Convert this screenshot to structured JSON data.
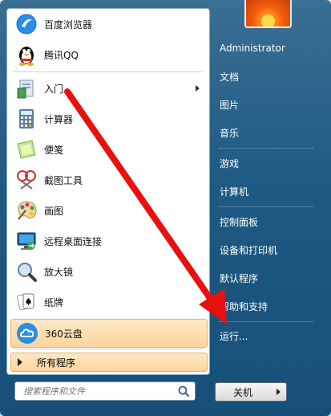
{
  "pinned_items": [
    {
      "name": "baidu-browser",
      "label": "百度浏览器",
      "icon": "baidu-browser-icon"
    },
    {
      "name": "tencent-qq",
      "label": "腾讯QQ",
      "icon": "qq-penguin-icon"
    }
  ],
  "recent_items": [
    {
      "name": "getting-started",
      "label": "入门",
      "icon": "getting-started-icon",
      "has_submenu": true
    },
    {
      "name": "calculator",
      "label": "计算器",
      "icon": "calculator-icon"
    },
    {
      "name": "sticky-notes",
      "label": "便笺",
      "icon": "sticky-notes-icon"
    },
    {
      "name": "snipping-tool",
      "label": "截图工具",
      "icon": "scissors-icon"
    },
    {
      "name": "paint",
      "label": "画图",
      "icon": "paint-palette-icon"
    },
    {
      "name": "remote-desktop",
      "label": "远程桌面连接",
      "icon": "remote-desktop-icon"
    },
    {
      "name": "magnifier",
      "label": "放大镜",
      "icon": "magnifier-icon"
    },
    {
      "name": "solitaire",
      "label": "纸牌",
      "icon": "cards-icon"
    },
    {
      "name": "cloud-360",
      "label": "360云盘",
      "icon": "cloud-icon",
      "highlighted": true
    }
  ],
  "all_programs_label": "所有程序",
  "search": {
    "placeholder": "搜索程序和文件"
  },
  "right_items": [
    {
      "name": "administrator",
      "label": "Administrator"
    },
    {
      "name": "documents",
      "label": "文档"
    },
    {
      "name": "pictures",
      "label": "图片"
    },
    {
      "name": "music",
      "label": "音乐"
    },
    {
      "name": "games",
      "label": "游戏"
    },
    {
      "name": "computer",
      "label": "计算机"
    },
    {
      "name": "control-panel",
      "label": "控制面板"
    },
    {
      "name": "devices-printers",
      "label": "设备和打印机"
    },
    {
      "name": "default-programs",
      "label": "默认程序"
    },
    {
      "name": "help-support",
      "label": "帮助和支持"
    },
    {
      "name": "run",
      "label": "运行..."
    }
  ],
  "shutdown_label": "关机",
  "colors": {
    "annotation_arrow": "#e8110f",
    "highlight": "#fbd59c",
    "menu_blue": "#1e5a83"
  }
}
